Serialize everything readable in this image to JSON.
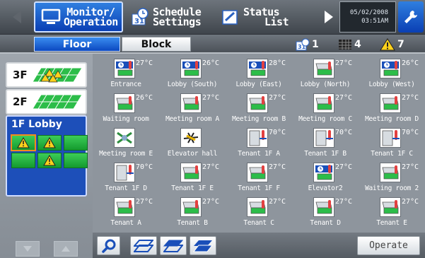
{
  "topbar": {
    "monitor_label_1": "Monitor/",
    "monitor_label_2": "Operation",
    "schedule_label_1": "Schedule",
    "schedule_label_2": "Settings",
    "status_label_1": "Status",
    "status_label_2": "List",
    "date": "05/02/2008",
    "time": "03:51AM"
  },
  "tabs": {
    "floor": "Floor",
    "block": "Block"
  },
  "counts": {
    "schedule": "1",
    "grid": "4",
    "alarm": "7"
  },
  "floors": [
    {
      "label": "3F"
    },
    {
      "label": "2F"
    },
    {
      "label": "1F Lobby"
    }
  ],
  "units": [
    {
      "name": "Entrance",
      "temp": "27°C"
    },
    {
      "name": "Lobby (South)",
      "temp": "26°C"
    },
    {
      "name": "Lobby (East)",
      "temp": "28°C"
    },
    {
      "name": "Lobby (North)",
      "temp": "27°C"
    },
    {
      "name": "Lobby (West)",
      "temp": "26°C"
    },
    {
      "name": "Waiting room",
      "temp": "26°C"
    },
    {
      "name": "Meeting room A",
      "temp": "27°C"
    },
    {
      "name": "Meeting room B",
      "temp": "27°C"
    },
    {
      "name": "Meeting room C",
      "temp": "27°C"
    },
    {
      "name": "Meeting room D",
      "temp": "27°C"
    },
    {
      "name": "Meeting room E",
      "temp": ""
    },
    {
      "name": "Elevator hall",
      "temp": ""
    },
    {
      "name": "Tenant 1F A",
      "temp": "70°C"
    },
    {
      "name": "Tenant 1F B",
      "temp": "70°C"
    },
    {
      "name": "Tenant 1F C",
      "temp": "70°C"
    },
    {
      "name": "Tenant 1F D",
      "temp": "70°C"
    },
    {
      "name": "Tenant 1F E",
      "temp": "27°C"
    },
    {
      "name": "Tenant 1F F",
      "temp": "27°C"
    },
    {
      "name": "Elevator2",
      "temp": "27°C"
    },
    {
      "name": "Waiting room 2",
      "temp": "27°C"
    },
    {
      "name": "Tenant A",
      "temp": "27°C"
    },
    {
      "name": "Tenant B",
      "temp": "27°C"
    },
    {
      "name": "Tenant C",
      "temp": "27°C"
    },
    {
      "name": "Tenant D",
      "temp": "27°C"
    },
    {
      "name": "Tenant E",
      "temp": "27°C"
    }
  ],
  "bottom": {
    "operate": "Operate"
  }
}
